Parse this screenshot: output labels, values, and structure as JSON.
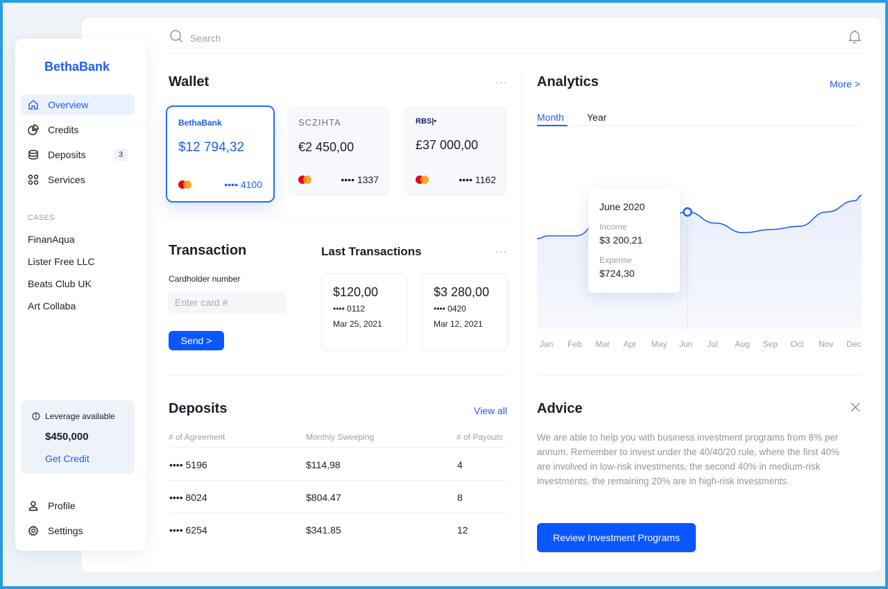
{
  "sidebar": {
    "logo": "BethaBank",
    "nav": [
      {
        "label": "Overview",
        "icon": "home-icon",
        "active": true
      },
      {
        "label": "Credits",
        "icon": "pie-chart-icon"
      },
      {
        "label": "Deposits",
        "icon": "database-icon",
        "badge": "3"
      },
      {
        "label": "Services",
        "icon": "grid-icon"
      }
    ],
    "cases_title": "CASES",
    "cases": [
      "FinanAqua",
      "Lister Free LLC",
      "Beats Club UK",
      "Art Collaba"
    ],
    "leverage": {
      "label": "Leverage available",
      "value": "$450,000",
      "link": "Get Credit"
    },
    "bottom": [
      {
        "label": "Profile",
        "icon": "user-icon"
      },
      {
        "label": "Settings",
        "icon": "gear-icon"
      }
    ]
  },
  "search": {
    "placeholder": "Search"
  },
  "wallet": {
    "title": "Wallet",
    "more": "···",
    "cards": [
      {
        "brand": "BethaBank",
        "amount": "$12 794,32",
        "number": "•••• 4100",
        "selected": true
      },
      {
        "brand": "SCZIHTA",
        "amount": "€2 450,00",
        "number": "•••• 1337"
      },
      {
        "brand": "RBS|•",
        "amount": "£37 000,00",
        "number": "•••• 1162"
      }
    ]
  },
  "transaction": {
    "title": "Transaction",
    "cardholder_label": "Cardholder number",
    "input_placeholder": "Enter card #",
    "send": "Send >"
  },
  "last_transactions": {
    "title": "Last Transactions",
    "more": "···",
    "items": [
      {
        "amount": "$120,00",
        "number": "•••• 0112",
        "date": "Mar 25, 2021"
      },
      {
        "amount": "$3 280,00",
        "number": "•••• 0420",
        "date": "Mar 12, 2021"
      }
    ]
  },
  "deposits": {
    "title": "Deposits",
    "view_all": "View all",
    "columns": [
      "# of Agreement",
      "Monthly Sweeping",
      "# of Payouts"
    ],
    "rows": [
      [
        "•••• 5196",
        "$114,98",
        "4"
      ],
      [
        "•••• 8024",
        "$804.47",
        "8"
      ],
      [
        "•••• 6254",
        "$341.85",
        "12"
      ]
    ]
  },
  "analytics": {
    "title": "Analytics",
    "more": "More >",
    "tabs": [
      "Month",
      "Year"
    ],
    "active_tab": "Month",
    "tooltip": {
      "title": "June 2020",
      "income_label": "Income",
      "income": "$3 200,21",
      "expense_label": "Expense",
      "expense": "$724,30"
    },
    "months": [
      "Jan",
      "Feb",
      "Mar",
      "Apr",
      "May",
      "Jun",
      "Jul",
      "Aug",
      "Sep",
      "Oct",
      "Nov",
      "Dec"
    ],
    "line_color": "#1f5bff"
  },
  "chart_data": {
    "type": "area",
    "categories": [
      "Jan",
      "Feb",
      "Mar",
      "Apr",
      "May",
      "Jun",
      "Jul",
      "Aug",
      "Sep",
      "Oct",
      "Nov",
      "Dec"
    ],
    "series": [
      {
        "values": [
          0.4,
          0.4,
          0.52,
          0.5,
          0.49,
          0.55,
          0.48,
          0.42,
          0.44,
          0.46,
          0.55,
          0.62
        ]
      }
    ],
    "highlight": {
      "category": "Jun"
    },
    "grid": false
  },
  "advice": {
    "title": "Advice",
    "text": "We are able to help you with business investment programs from 8% per annum. Remember to invest under the 40/40/20 rule, where the first 40% are involved in low-risk investments, the second 40% in medium-risk investments, the remaining 20% are in high-risk investments.",
    "button": "Review Investment Programs"
  }
}
